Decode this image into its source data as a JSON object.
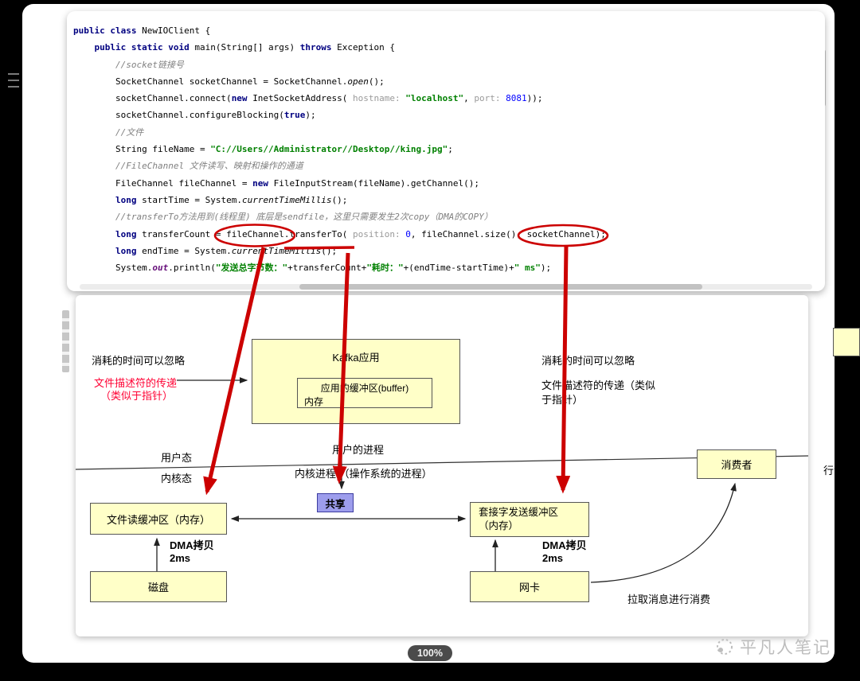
{
  "colors": {
    "accent_red": "#cc0000",
    "fd_label_red": "#ff0033",
    "box_yellow": "#ffffc8",
    "share_purple": "#9d9dec",
    "keyword_blue": "#000080",
    "string_green": "#008000",
    "number_blue": "#0000ff",
    "comment_gray": "#808080"
  },
  "viewer": {
    "zoom_badge": "100%",
    "watermark": "平凡人笔记"
  },
  "code": {
    "lines": [
      [
        {
          "s": "k",
          "t": "public class "
        },
        {
          "s": "p",
          "t": "NewIOClient {"
        }
      ],
      [
        {
          "s": "p",
          "t": "    "
        },
        {
          "s": "k",
          "t": "public static void "
        },
        {
          "s": "p",
          "t": "main(String[] args) "
        },
        {
          "s": "k",
          "t": "throws "
        },
        {
          "s": "p",
          "t": "Exception {"
        }
      ],
      [
        {
          "s": "p",
          "t": "        "
        },
        {
          "s": "c",
          "t": "//socket链接号"
        }
      ],
      [
        {
          "s": "p",
          "t": "        SocketChannel socketChannel = SocketChannel."
        },
        {
          "s": "i",
          "t": "open"
        },
        {
          "s": "p",
          "t": "();"
        }
      ],
      [
        {
          "s": "p",
          "t": "        socketChannel.connect("
        },
        {
          "s": "k",
          "t": "new "
        },
        {
          "s": "p",
          "t": "InetSocketAddress( "
        },
        {
          "s": "h",
          "t": "hostname: "
        },
        {
          "s": "s",
          "t": "\"localhost\""
        },
        {
          "s": "p",
          "t": ", "
        },
        {
          "s": "h",
          "t": "port: "
        },
        {
          "s": "n",
          "t": "8081"
        },
        {
          "s": "p",
          "t": "));"
        }
      ],
      [
        {
          "s": "p",
          "t": "        socketChannel.configureBlocking("
        },
        {
          "s": "k",
          "t": "true"
        },
        {
          "s": "p",
          "t": ");"
        }
      ],
      [
        {
          "s": "p",
          "t": "        "
        },
        {
          "s": "c",
          "t": "//文件"
        }
      ],
      [
        {
          "s": "p",
          "t": "        String fileName = "
        },
        {
          "s": "s",
          "t": "\"C://Users//Administrator//Desktop//king.jpg\""
        },
        {
          "s": "p",
          "t": ";"
        }
      ],
      [
        {
          "s": "p",
          "t": "        "
        },
        {
          "s": "c",
          "t": "//FileChannel 文件读写、映射和操作的通道"
        }
      ],
      [
        {
          "s": "p",
          "t": "        FileChannel fileChannel = "
        },
        {
          "s": "k",
          "t": "new "
        },
        {
          "s": "p",
          "t": "FileInputStream(fileName).getChannel();"
        }
      ],
      [
        {
          "s": "p",
          "t": "        "
        },
        {
          "s": "k",
          "t": "long "
        },
        {
          "s": "p",
          "t": "startTime = System."
        },
        {
          "s": "i",
          "t": "currentTimeMillis"
        },
        {
          "s": "p",
          "t": "();"
        }
      ],
      [
        {
          "s": "p",
          "t": "        "
        },
        {
          "s": "c",
          "t": "//transferTo方法用到(线程里) 底层是sendfile，这里只需要发生2次copy（DMA的COPY）"
        }
      ],
      [
        {
          "s": "p",
          "t": "        "
        },
        {
          "s": "k",
          "t": "long "
        },
        {
          "s": "p",
          "t": "transferCount = fileChannel.transferTo( "
        },
        {
          "s": "h",
          "t": "position: "
        },
        {
          "s": "n",
          "t": "0"
        },
        {
          "s": "p",
          "t": ", fileChannel.size(), socketChannel);"
        }
      ],
      [
        {
          "s": "p",
          "t": "        "
        },
        {
          "s": "k",
          "t": "long "
        },
        {
          "s": "p",
          "t": "endTime = System."
        },
        {
          "s": "i",
          "t": "currentTimeMillis"
        },
        {
          "s": "p",
          "t": "();"
        }
      ],
      [
        {
          "s": "p",
          "t": "        System."
        },
        {
          "s": "f",
          "t": "out"
        },
        {
          "s": "p",
          "t": ".println("
        },
        {
          "s": "s",
          "t": "\"发送总字节数：\""
        },
        {
          "s": "p",
          "t": "+transferCount+"
        },
        {
          "s": "s",
          "t": "\"耗时：\""
        },
        {
          "s": "p",
          "t": "+(endTime-startTime)+"
        },
        {
          "s": "s",
          "t": "\" ms\""
        },
        {
          "s": "p",
          "t": ");"
        }
      ]
    ]
  },
  "diagram": {
    "left_time_label": "消耗的时间可以忽略",
    "left_fd_label_line1": "文件描述符的传递",
    "left_fd_label_line2": "（类似于指针）",
    "right_time_label": "消耗的时间可以忽略",
    "right_fd_label_line1": "文件描述符的传递（类似",
    "right_fd_label_line2": "于指针）",
    "kafka_box_title": "Kafka应用",
    "kafka_buffer_line1": "应用的缓冲区(buffer)",
    "kafka_buffer_line2": "内存",
    "user_process_label": "用户的进程",
    "user_mode_label": "用户态",
    "kernel_mode_label": "内核态",
    "kernel_process_label": "内核进程 （操作系统的进程）",
    "share_box": "共享",
    "file_buffer_box": "文件读缓冲区（内存）",
    "socket_buffer_line1": "套接字发送缓冲区",
    "socket_buffer_line2": "（内存）",
    "consumer_box": "消费者",
    "disk_box": "磁盘",
    "nic_box": "网卡",
    "dma_copy_left_line1": "DMA拷贝",
    "dma_copy_left_line2": "2ms",
    "dma_copy_right_line1": "DMA拷贝",
    "dma_copy_right_line2": "2ms",
    "pull_consume_label": "拉取消息进行消费",
    "clipped_right_text": "行消费"
  }
}
